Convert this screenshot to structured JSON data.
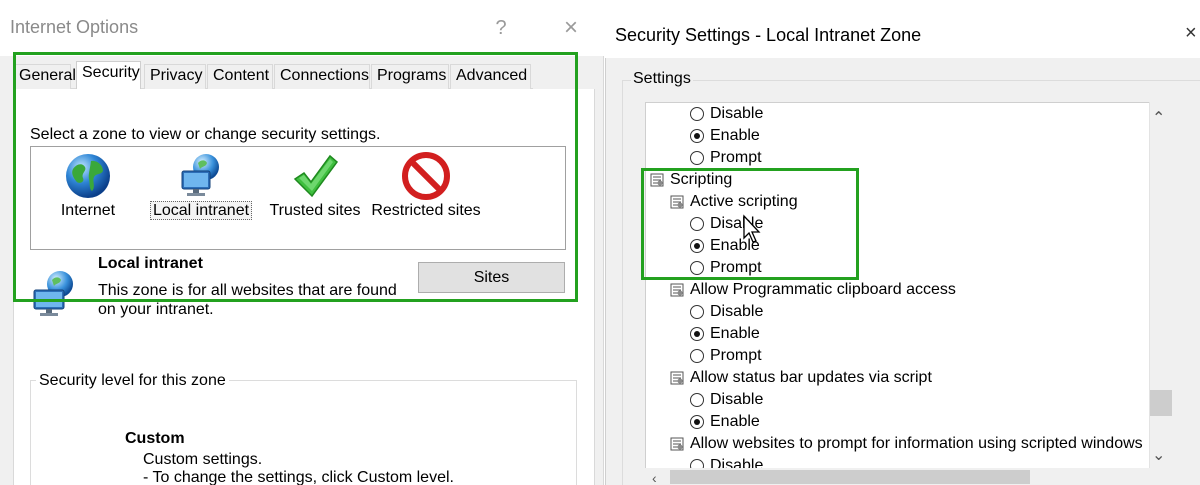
{
  "internet_options": {
    "title": "Internet Options",
    "help_button": "?",
    "close_button": "×",
    "tabs": [
      {
        "label": "General"
      },
      {
        "label": "Security"
      },
      {
        "label": "Privacy"
      },
      {
        "label": "Content"
      },
      {
        "label": "Connections"
      },
      {
        "label": "Programs"
      },
      {
        "label": "Advanced"
      }
    ],
    "active_tab": "Security",
    "zone_instruction": "Select a zone to view or change security settings.",
    "zones": [
      {
        "label": "Internet",
        "icon": "globe-icon"
      },
      {
        "label": "Local intranet",
        "icon": "local-intranet-icon"
      },
      {
        "label": "Trusted sites",
        "icon": "checkmark-icon"
      },
      {
        "label": "Restricted sites",
        "icon": "restricted-icon"
      }
    ],
    "selected_zone": {
      "name": "Local intranet",
      "description": "This zone is for all websites that are found on your intranet.",
      "sites_button": "Sites"
    },
    "security_level": {
      "group_title": "Security level for this zone",
      "level_name": "Custom",
      "line1": "Custom settings.",
      "line2": "- To change the settings, click Custom level."
    }
  },
  "security_settings": {
    "title": "Security Settings - Local Intranet Zone",
    "close_button": "×",
    "settings_label": "Settings",
    "tree": [
      {
        "type": "option",
        "label": "Disable",
        "checked": false
      },
      {
        "type": "option",
        "label": "Enable",
        "checked": true
      },
      {
        "type": "option",
        "label": "Prompt",
        "checked": false
      },
      {
        "type": "category",
        "label": "Scripting"
      },
      {
        "type": "setting",
        "label": "Active scripting"
      },
      {
        "type": "option",
        "label": "Disable",
        "checked": false
      },
      {
        "type": "option",
        "label": "Enable",
        "checked": true
      },
      {
        "type": "option",
        "label": "Prompt",
        "checked": false
      },
      {
        "type": "setting",
        "label": "Allow Programmatic clipboard access"
      },
      {
        "type": "option",
        "label": "Disable",
        "checked": false
      },
      {
        "type": "option",
        "label": "Enable",
        "checked": true
      },
      {
        "type": "option",
        "label": "Prompt",
        "checked": false
      },
      {
        "type": "setting",
        "label": "Allow status bar updates via script"
      },
      {
        "type": "option",
        "label": "Disable",
        "checked": false
      },
      {
        "type": "option",
        "label": "Enable",
        "checked": true
      },
      {
        "type": "setting",
        "label": "Allow websites to prompt for information using scripted windows"
      },
      {
        "type": "option",
        "label": "Disable",
        "checked": false
      }
    ]
  },
  "colors": {
    "highlight": "#23a11f",
    "window_bg": "#f0f0f0",
    "panel_bg": "#ffffff"
  }
}
